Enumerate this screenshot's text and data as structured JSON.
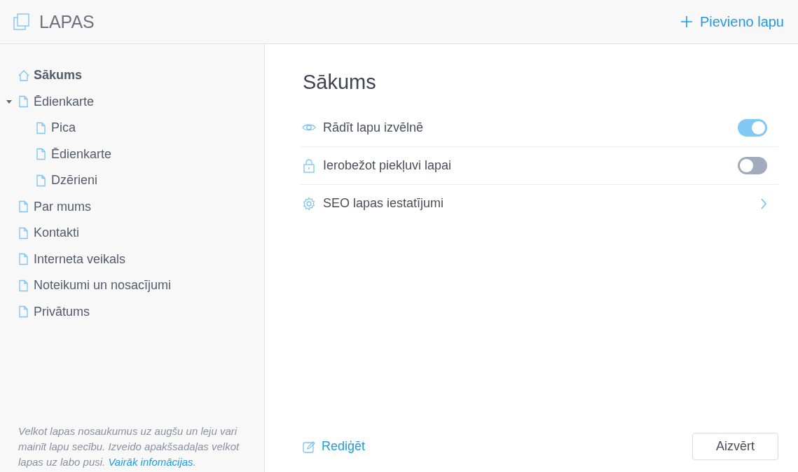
{
  "header": {
    "title": "LAPAS",
    "add_button": "Pievieno lapu"
  },
  "sidebar": {
    "items": [
      {
        "label": "Sākums",
        "kind": "home",
        "selected": true
      },
      {
        "label": "Ēdienkarte",
        "kind": "page",
        "selected": false,
        "expanded": true,
        "children": [
          {
            "label": "Pica",
            "kind": "page",
            "selected": false
          },
          {
            "label": "Ēdienkarte",
            "kind": "page",
            "selected": false
          },
          {
            "label": "Dzērieni",
            "kind": "page",
            "selected": false
          }
        ]
      },
      {
        "label": "Par mums",
        "kind": "page",
        "selected": false
      },
      {
        "label": "Kontakti",
        "kind": "page",
        "selected": false
      },
      {
        "label": "Interneta veikals",
        "kind": "page",
        "selected": false
      },
      {
        "label": "Noteikumi un nosacījumi",
        "kind": "page",
        "selected": false
      },
      {
        "label": "Privātums",
        "kind": "page",
        "selected": false
      }
    ],
    "help": {
      "text": "Velkot lapas nosaukumus uz augšu un leju vari mainīt lapu secību. Izveido apakšsadaļas velkot lapas uz labo pusi.",
      "link": "Vairāk infomācijas",
      "end": "."
    }
  },
  "content": {
    "title": "Sākums",
    "settings": [
      {
        "label": "Rādīt lapu izvēlnē",
        "kind": "toggle",
        "on": true
      },
      {
        "label": "Ierobežot piekļuvi lapai",
        "kind": "toggle",
        "on": false
      },
      {
        "label": "SEO lapas iestatījumi",
        "kind": "link"
      }
    ],
    "edit_link": "Rediģēt",
    "close_button": "Aizvērt"
  }
}
